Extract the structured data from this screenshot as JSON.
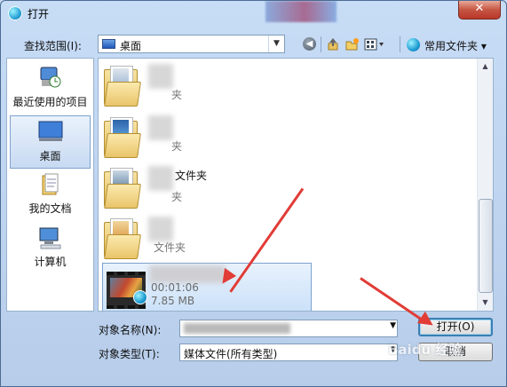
{
  "window": {
    "title": "打开",
    "close_glyph": "✕"
  },
  "toolbar": {
    "lookin_label": "查找范围(I):",
    "lookin_value": "桌面",
    "places_label": "常用文件夹"
  },
  "sidebar": {
    "items": [
      {
        "label": "最近使用的项目",
        "icon": "recent-items-icon"
      },
      {
        "label": "桌面",
        "icon": "desktop-icon",
        "selected": true
      },
      {
        "label": "我的文档",
        "icon": "documents-icon"
      },
      {
        "label": "计算机",
        "icon": "computer-icon"
      }
    ]
  },
  "files": [
    {
      "name": "夹",
      "type": "folder"
    },
    {
      "name": "夹",
      "type": "folder"
    },
    {
      "name": "文件夹",
      "name_top": "文件夹",
      "name_bottom": "夹",
      "type": "folder"
    },
    {
      "name": "文件夹",
      "type": "folder"
    }
  ],
  "video": {
    "duration": "00:01:06",
    "size": "7.85 MB"
  },
  "footer": {
    "name_label": "对象名称(N):",
    "type_label": "对象类型(T):",
    "type_value": "媒体文件(所有类型)",
    "open_button": "打开(O)",
    "cancel_button": "取消"
  },
  "watermark": "Baidu 经验",
  "colors": {
    "arrow": "#e13c36",
    "accent": "#3c7fb1"
  }
}
